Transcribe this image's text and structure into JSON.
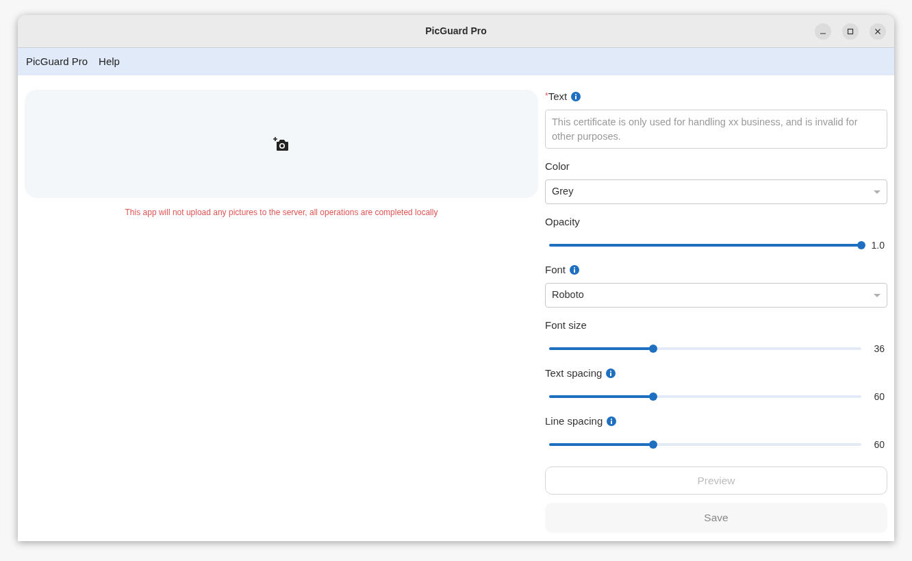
{
  "window": {
    "title": "PicGuard Pro"
  },
  "menu": [
    "PicGuard Pro",
    "Help"
  ],
  "upload": {
    "notice": "This app will not upload any pictures to the server, all operations are completed locally"
  },
  "fields": [
    {
      "kind": "textarea",
      "required_mark": "*",
      "label": "Text",
      "info": true,
      "placeholder": "This certificate is only used for handling xx business, and is invalid for other purposes."
    },
    {
      "kind": "select",
      "label": "Color",
      "info": false,
      "value": "Grey"
    },
    {
      "kind": "slider",
      "label": "Opacity",
      "info": false,
      "level": 1,
      "reading": "1.0"
    },
    {
      "kind": "select",
      "label": "Font",
      "info": true,
      "value": "Roboto"
    },
    {
      "kind": "slider",
      "label": "Font size",
      "info": false,
      "level": 0.333,
      "reading": "36"
    },
    {
      "kind": "slider",
      "label": "Text spacing",
      "info": true,
      "level": 0.333,
      "reading": "60"
    },
    {
      "kind": "slider",
      "label": "Line spacing",
      "info": true,
      "level": 0.333,
      "reading": "60"
    }
  ],
  "buttons": [
    {
      "kind": "outlined",
      "label": "Preview",
      "disabled": true
    },
    {
      "kind": "filled",
      "label": "Save",
      "disabled": true
    }
  ]
}
